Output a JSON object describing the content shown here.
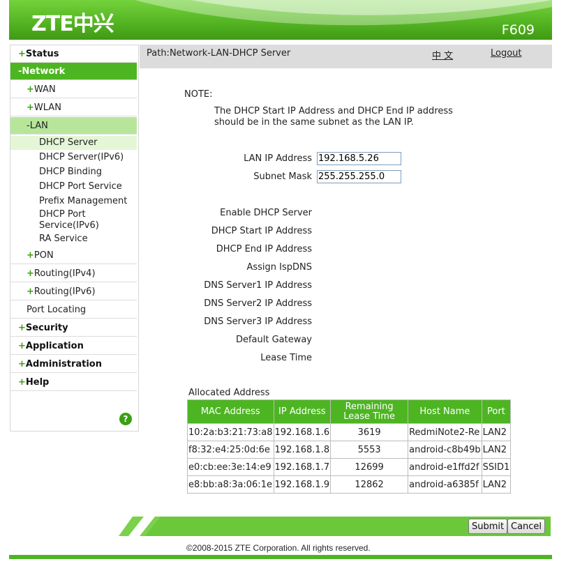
{
  "header": {
    "logo": "ZTE中兴",
    "model": "F609"
  },
  "sidebar": {
    "status": "Status",
    "network": "Network",
    "wan": "WAN",
    "wlan": "WLAN",
    "lan": "LAN",
    "lan_items": [
      "DHCP Server",
      "DHCP Server(IPv6)",
      "DHCP Binding",
      "DHCP Port Service",
      "Prefix Management",
      "DHCP Port",
      "Service(IPv6)",
      "RA Service"
    ],
    "pon": "PON",
    "routing_v4": "Routing(IPv4)",
    "routing_v6": "Routing(IPv6)",
    "port_locating": "Port Locating",
    "security": "Security",
    "application": "Application",
    "administration": "Administration",
    "help": "Help",
    "plus": "+",
    "minus": "-",
    "help_icon_glyph": "?"
  },
  "pathbar": {
    "path": "Path:Network-LAN-DHCP Server",
    "lang": "中 文",
    "logout": "Logout"
  },
  "note": {
    "title": "NOTE:",
    "text": "The DHCP Start IP Address and DHCP End IP address should be in the same subnet as the LAN IP."
  },
  "form": {
    "lan_ip_label": "LAN IP Address",
    "lan_ip_value": "192.168.5.26",
    "subnet_label": "Subnet Mask",
    "subnet_value": "255.255.255.0",
    "enable_dhcp": "Enable DHCP Server",
    "dhcp_start": "DHCP Start IP Address",
    "dhcp_end": "DHCP End IP Address",
    "assign_isp_dns": "Assign IspDNS",
    "dns1": "DNS Server1 IP Address",
    "dns2": "DNS Server2 IP Address",
    "dns3": "DNS Server3 IP Address",
    "gateway": "Default Gateway",
    "lease": "Lease Time"
  },
  "allocated": {
    "title": "Allocated Address",
    "headers": [
      "MAC Address",
      "IP Address",
      "Remaining Lease Time",
      "Host Name",
      "Port"
    ],
    "rows": [
      [
        "10:2a:b3:21:73:a8",
        "192.168.1.6",
        "3619",
        "RedmiNote2-Re",
        "LAN2"
      ],
      [
        "f8:32:e4:25:0d:6e",
        "192.168.1.8",
        "5553",
        "android-c8b49b",
        "LAN2"
      ],
      [
        "e0:cb:ee:3e:14:e9",
        "192.168.1.7",
        "12699",
        "android-e1ffd2f",
        "SSID1"
      ],
      [
        "e8:bb:a8:3a:06:1e",
        "192.168.1.9",
        "12862",
        "android-a6385f",
        "LAN2"
      ]
    ]
  },
  "buttons": {
    "submit": "Submit",
    "cancel": "Cancel"
  },
  "footer": {
    "copyright": "©2008-2015 ZTE Corporation. All rights reserved."
  },
  "colors": {
    "brand_green": "#4db522",
    "light_green": "#b7e69b",
    "path_gray": "#dcdcdc"
  }
}
